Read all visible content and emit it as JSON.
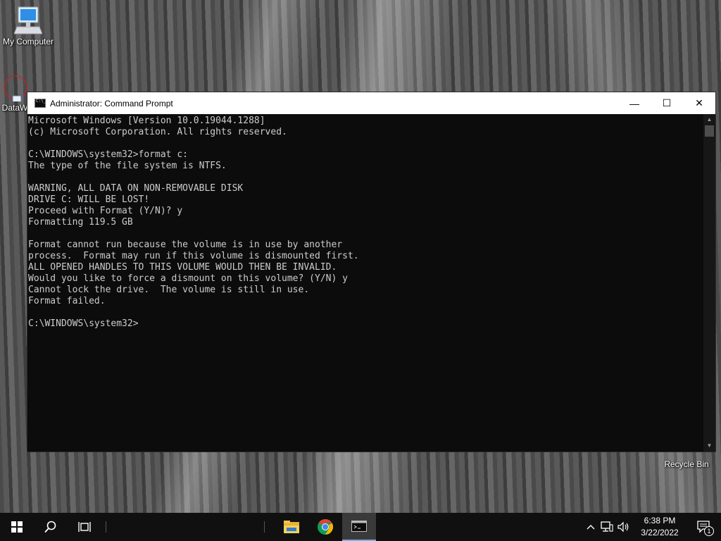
{
  "desktop": {
    "icons": [
      {
        "label": "My Computer"
      },
      {
        "label": "DataW"
      },
      {
        "label": "Recycle Bin"
      }
    ]
  },
  "window": {
    "title": "Administrator: Command Prompt",
    "controls": {
      "minimize": "—",
      "maximize": "☐",
      "close": "✕"
    },
    "console_text": "Microsoft Windows [Version 10.0.19044.1288]\n(c) Microsoft Corporation. All rights reserved.\n\nC:\\WINDOWS\\system32>format c:\nThe type of the file system is NTFS.\n\nWARNING, ALL DATA ON NON-REMOVABLE DISK\nDRIVE C: WILL BE LOST!\nProceed with Format (Y/N)? y\nFormatting 119.5 GB\n\nFormat cannot run because the volume is in use by another\nprocess.  Format may run if this volume is dismounted first.\nALL OPENED HANDLES TO THIS VOLUME WOULD THEN BE INVALID.\nWould you like to force a dismount on this volume? (Y/N) y\nCannot lock the drive.  The volume is still in use.\nFormat failed.\n\nC:\\WINDOWS\\system32>",
    "scroll_up": "▲",
    "scroll_down": "▼"
  },
  "taskbar": {
    "apps": [
      "start-icon",
      "search-icon",
      "task-view-icon",
      "file-explorer-icon",
      "chrome-icon",
      "command-prompt-icon"
    ],
    "clock": {
      "time": "6:38 PM",
      "date": "3/22/2022"
    },
    "notification_count": "1",
    "tray_chevron": "^"
  }
}
